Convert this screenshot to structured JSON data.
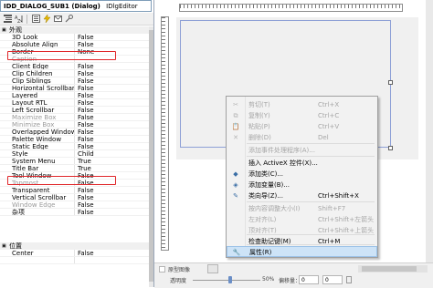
{
  "object_selector": {
    "name": "IDD_DIALOG_SUB1 (Dialog)",
    "editor": "IDlgEditor"
  },
  "toolbar_icons": [
    "categorized-icon",
    "alphabetical-icon",
    "properties-icon",
    "events-icon",
    "messages-icon",
    "overrides-icon"
  ],
  "categories": {
    "appearance": "外观",
    "position": "位置"
  },
  "properties_appearance": [
    {
      "name": "3D Look",
      "value": "False",
      "disabled": false
    },
    {
      "name": "Absolute Align",
      "value": "False",
      "disabled": false
    },
    {
      "name": "Border",
      "value": "None",
      "disabled": false
    },
    {
      "name": "Caption",
      "value": "",
      "disabled": true
    },
    {
      "name": "Client Edge",
      "value": "False",
      "disabled": false
    },
    {
      "name": "Clip Children",
      "value": "False",
      "disabled": false
    },
    {
      "name": "Clip Siblings",
      "value": "False",
      "disabled": false
    },
    {
      "name": "Horizontal Scrollbar",
      "value": "False",
      "disabled": false
    },
    {
      "name": "Layered",
      "value": "False",
      "disabled": false
    },
    {
      "name": "Layout RTL",
      "value": "False",
      "disabled": false
    },
    {
      "name": "Left Scrollbar",
      "value": "False",
      "disabled": false
    },
    {
      "name": "Maximize Box",
      "value": "False",
      "disabled": true
    },
    {
      "name": "Minimize Box",
      "value": "False",
      "disabled": true
    },
    {
      "name": "Overlapped Window",
      "value": "False",
      "disabled": false
    },
    {
      "name": "Palette Window",
      "value": "False",
      "disabled": false
    },
    {
      "name": "Static Edge",
      "value": "False",
      "disabled": false
    },
    {
      "name": "Style",
      "value": "Child",
      "disabled": false
    },
    {
      "name": "System Menu",
      "value": "True",
      "disabled": false
    },
    {
      "name": "Title Bar",
      "value": "True",
      "disabled": false
    },
    {
      "name": "Tool Window",
      "value": "False",
      "disabled": false
    },
    {
      "name": "Topmost",
      "value": "False",
      "disabled": true
    },
    {
      "name": "Transparent",
      "value": "False",
      "disabled": false
    },
    {
      "name": "Vertical Scrollbar",
      "value": "False",
      "disabled": false
    },
    {
      "name": "Window Edge",
      "value": "False",
      "disabled": true
    },
    {
      "name": "杂项",
      "value": "False",
      "disabled": false
    }
  ],
  "properties_position": [
    {
      "name": "Center",
      "value": "False",
      "disabled": false
    },
    {
      "name": "",
      "value": "",
      "disabled": false
    }
  ],
  "context_menu": [
    {
      "label": "剪切(T)",
      "shortcut": "Ctrl+X",
      "icon": "cut-icon",
      "disabled": true
    },
    {
      "label": "复制(Y)",
      "shortcut": "Ctrl+C",
      "icon": "copy-icon",
      "disabled": true
    },
    {
      "label": "粘贴(P)",
      "shortcut": "Ctrl+V",
      "icon": "paste-icon",
      "disabled": true
    },
    {
      "label": "删除(D)",
      "shortcut": "Del",
      "icon": "delete-icon",
      "disabled": true
    },
    {
      "label": "添加事件处理程序(A)...",
      "shortcut": "",
      "icon": "",
      "disabled": true
    },
    {
      "label": "插入 ActiveX 控件(X)...",
      "shortcut": "",
      "icon": "",
      "disabled": false
    },
    {
      "label": "添加类(C)...",
      "shortcut": "",
      "icon": "add-class-icon",
      "disabled": false
    },
    {
      "label": "添加变量(B)...",
      "shortcut": "",
      "icon": "add-variable-icon",
      "disabled": false
    },
    {
      "label": "类向导(Z)...",
      "shortcut": "Ctrl+Shift+X",
      "icon": "class-wizard-icon",
      "disabled": false
    },
    {
      "label": "按内容调整大小(I)",
      "shortcut": "Shift+F7",
      "icon": "",
      "disabled": true
    },
    {
      "label": "左对齐(L)",
      "shortcut": "Ctrl+Shift+左箭头",
      "icon": "",
      "disabled": true
    },
    {
      "label": "顶对齐(T)",
      "shortcut": "Ctrl+Shift+上箭头",
      "icon": "",
      "disabled": true
    },
    {
      "label": "检查助记键(M)",
      "shortcut": "Ctrl+M",
      "icon": "",
      "disabled": false
    },
    {
      "label": "属性(R)",
      "shortcut": "",
      "icon": "properties-wrench-icon",
      "disabled": false
    }
  ],
  "bottom_bar": {
    "fill_image_label": "原型图像",
    "transparency_label": "透明度",
    "percent": "50%",
    "offset_label": "偏移量：",
    "offset_value": "0",
    "level": 0.55
  }
}
